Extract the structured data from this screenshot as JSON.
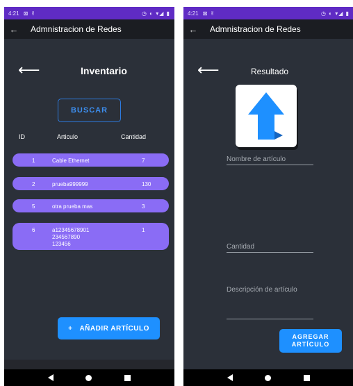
{
  "statusbar": {
    "time": "4:21",
    "notif_icons": "⊠ ✌",
    "system_icons": "◷ ◐ ▾◢ ▮"
  },
  "appbar": {
    "title": "Admnistracion de Redes",
    "back_glyph": "←"
  },
  "inventario": {
    "back_glyph": "⟵",
    "title": "Inventario",
    "buscar_label": "BUSCAR",
    "columns": {
      "id": "ID",
      "articulo": "Articulo",
      "cantidad": "Cantidad"
    },
    "rows": [
      {
        "id": "1",
        "name": "Cable Ethernet",
        "qty": "7"
      },
      {
        "id": "2",
        "name": "prueba999999",
        "qty": "130"
      },
      {
        "id": "5",
        "name": "otra prueba mas",
        "qty": "3"
      },
      {
        "id": "6",
        "name": "a12345678901\n234567890\n123456",
        "qty": "1"
      }
    ],
    "add_plus": "+",
    "add_label": "AÑADIR ARTÍCULO"
  },
  "resultado": {
    "back_glyph": "⟵",
    "title": "Resultado",
    "image_icon": "up-arrow-icon",
    "image_color": "#1e90ff",
    "name_placeholder": "Nombre de artículo",
    "qty_placeholder": "Cantidad",
    "desc_placeholder": "Descripción de artículo",
    "agregar_line1": "AGREGAR",
    "agregar_line2": "ARTÍCULO"
  },
  "colors": {
    "statusbar": "#5f2bc4",
    "background": "#2b3039",
    "row": "#8a6cf5",
    "accent": "#1e90ff"
  }
}
